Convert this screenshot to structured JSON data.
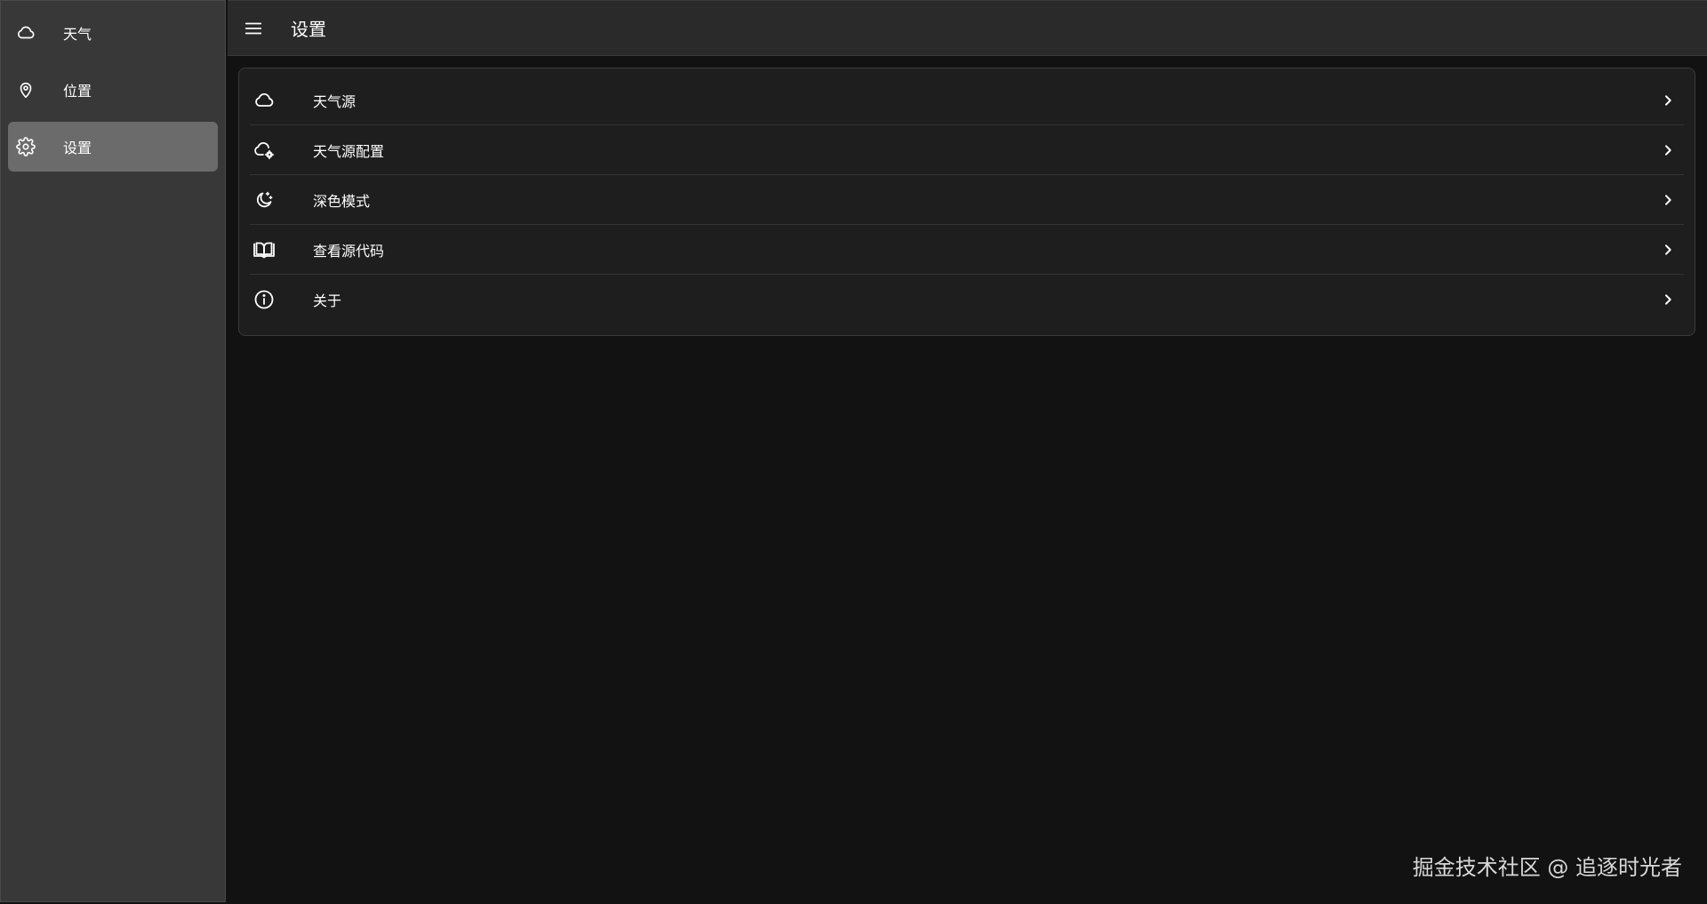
{
  "sidebar": {
    "items": [
      {
        "label": "天气",
        "icon": "cloud-icon",
        "active": false
      },
      {
        "label": "位置",
        "icon": "location-pin-icon",
        "active": false
      },
      {
        "label": "设置",
        "icon": "gear-icon",
        "active": true
      }
    ]
  },
  "header": {
    "menu_icon": "hamburger-menu-icon",
    "title": "设置"
  },
  "settings": {
    "items": [
      {
        "label": "天气源",
        "icon": "cloud-icon"
      },
      {
        "label": "天气源配置",
        "icon": "cloud-settings-icon"
      },
      {
        "label": "深色模式",
        "icon": "moon-icon"
      },
      {
        "label": "查看源代码",
        "icon": "open-book-icon"
      },
      {
        "label": "关于",
        "icon": "info-circle-icon"
      }
    ],
    "chevron_icon": "chevron-right-icon"
  },
  "watermark": {
    "text": "掘金技术社区 @ 追逐时光者"
  },
  "colors": {
    "sidebar_bg": "#383838",
    "sidebar_active": "#6b6b6b",
    "topbar_bg": "#2a2a2a",
    "content_bg": "#121212",
    "card_bg": "#1e1e1e",
    "text": "#ffffff"
  }
}
